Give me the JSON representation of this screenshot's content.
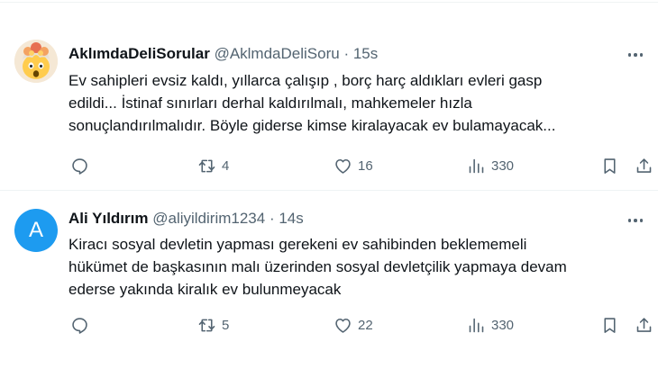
{
  "tweets": [
    {
      "name": "AklımdaDeliSorular",
      "handle": "@AklmdaDeliSoru",
      "separator": "·",
      "time": "15s",
      "avatar": {
        "type": "emoji",
        "glyph": "🤯"
      },
      "text_lines": [
        "Ev sahipleri evsiz kaldı, yıllarca çalışıp , borç harç aldıkları evleri gasp",
        "edildi... İstinaf sınırları derhal kaldırılmalı, mahkemeler hızla",
        "sonuçlandırılmalıdır. Böyle giderse kimse kiralayacak ev bulamayacak..."
      ],
      "replies": "",
      "retweets": "4",
      "likes": "16",
      "views": "330"
    },
    {
      "name": "Ali Yıldırım",
      "handle": "@aliyildirim1234",
      "separator": "·",
      "time": "14s",
      "avatar": {
        "type": "letter",
        "letter": "A",
        "color": "#1d9bf0"
      },
      "text_lines": [
        "Kiracı sosyal devletin yapması gerekeni ev sahibinden beklememeli",
        "hükümet de başkasının malı üzerinden sosyal devletçilik yapmaya devam",
        "ederse yakında kiralık ev bulunmeyacak"
      ],
      "replies": "",
      "retweets": "5",
      "likes": "22",
      "views": "330"
    }
  ],
  "icons": {
    "reply": "reply-icon",
    "retweet": "retweet-icon",
    "like": "heart-icon",
    "views": "views-icon",
    "bookmark": "bookmark-icon",
    "share": "share-icon",
    "more": "more-icon"
  },
  "colors": {
    "text": "#0f1419",
    "secondary": "#536471",
    "divider": "#eff3f4",
    "avatar_blue": "#1d9bf0"
  }
}
